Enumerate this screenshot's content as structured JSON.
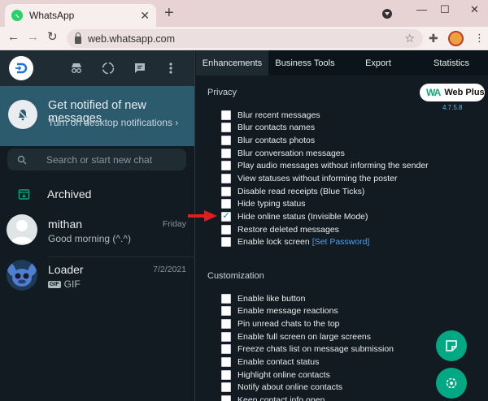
{
  "browser": {
    "tab_title": "WhatsApp",
    "url": "web.whatsapp.com",
    "icons": [
      "whatsapp-favicon",
      "close-icon",
      "plus-icon",
      "tab-search-icon",
      "minimize-icon",
      "maximize-icon",
      "close-window-icon",
      "back-icon",
      "forward-icon",
      "reload-icon",
      "lock-icon",
      "star-icon",
      "extensions-icon",
      "profile-avatar",
      "menu-icon"
    ]
  },
  "sidebar": {
    "header_icons": [
      "profile-avatar",
      "incognito-icon",
      "status-icon",
      "new-chat-icon",
      "menu-icon"
    ],
    "notification": {
      "title": "Get notified of new messages",
      "subtitle": "Turn on desktop notifications ›"
    },
    "search_placeholder": "Search or start new chat",
    "archived_label": "Archived",
    "chats": [
      {
        "name": "mithan",
        "time": "Friday",
        "message": "Good morning (^.^)"
      },
      {
        "name": "Loader",
        "time": "7/2/2021",
        "badge": "GIF",
        "message": "GIF"
      }
    ]
  },
  "extension": {
    "tabs": [
      "Enhancements",
      "Business Tools",
      "Export",
      "Statistics"
    ],
    "active_tab": "Enhancements",
    "brand": {
      "mark": "WA",
      "name": "Web Plus",
      "version": "4.7.5.8"
    },
    "privacy": {
      "title": "Privacy",
      "options": [
        {
          "label": "Blur recent messages",
          "checked": false
        },
        {
          "label": "Blur contacts names",
          "checked": false
        },
        {
          "label": "Blur contacts photos",
          "checked": false
        },
        {
          "label": "Blur conversation messages",
          "checked": false
        },
        {
          "label": "Play audio messages without informing the sender",
          "checked": false
        },
        {
          "label": "View statuses without informing the poster",
          "checked": false
        },
        {
          "label": "Disable read receipts (Blue Ticks)",
          "checked": false
        },
        {
          "label": "Hide typing status",
          "checked": false
        },
        {
          "label": "Hide online status (Invisible Mode)",
          "checked": true
        },
        {
          "label": "Restore deleted messages",
          "checked": false
        },
        {
          "label": "Enable lock screen",
          "link": "[Set Password]",
          "checked": false
        }
      ]
    },
    "customization": {
      "title": "Customization",
      "options": [
        {
          "label": "Enable like button",
          "checked": false
        },
        {
          "label": "Enable message reactions",
          "checked": false
        },
        {
          "label": "Pin unread chats to the top",
          "checked": false
        },
        {
          "label": "Enable full screen on large screens",
          "checked": false
        },
        {
          "label": "Freeze chats list on message submission",
          "checked": false
        },
        {
          "label": "Enable contact status",
          "checked": false
        },
        {
          "label": "Highlight online contacts",
          "checked": false
        },
        {
          "label": "Notify about online contacts",
          "checked": false
        },
        {
          "label": "Keep contact info open",
          "checked": false
        }
      ]
    },
    "fab_icons": [
      "sticker-icon",
      "settings-icon"
    ]
  },
  "colors": {
    "whatsapp_green": "#00a884",
    "notification_banner": "#2c5b6e",
    "pointer_arrow": "#e11d1d",
    "checkbox_check": "#1c74d4",
    "link": "#4aa3f0"
  }
}
